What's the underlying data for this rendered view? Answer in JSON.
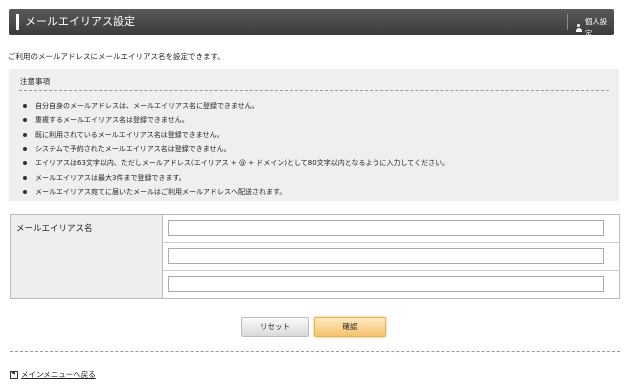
{
  "header": {
    "title": "メールエイリアス設定",
    "profile_label": "個人設定"
  },
  "intro_text": "ご利用のメールアドレスにメールエイリアス名を設定できます。",
  "notice": {
    "title": "注意事項",
    "items": [
      "自分自身のメールアドレスは、メールエイリアス名に登録できません。",
      "重複するメールエイリアス名は登録できません。",
      "既に利用されているメールエイリアス名は登録できません。",
      "システムで予約されたメールエイリアス名は登録できません。",
      "エイリアスは63文字以内、ただしメールアドレス(エイリアス + @ + ドメイン)として80文字以内となるように入力してください。",
      "メールエイリアスは最大3件まで登録できます。",
      "メールエイリアス宛てに届いたメールはご利用メールアドレスへ配送されます。"
    ]
  },
  "form": {
    "label": "メールエイリアス名",
    "alias_values": [
      "",
      "",
      ""
    ]
  },
  "buttons": {
    "reset": "リセット",
    "confirm": "確認"
  },
  "back_link": "メインメニューへ戻る",
  "colors": {
    "header_bg": "#4a4a4a",
    "confirm_bg": "#f6c36d"
  }
}
